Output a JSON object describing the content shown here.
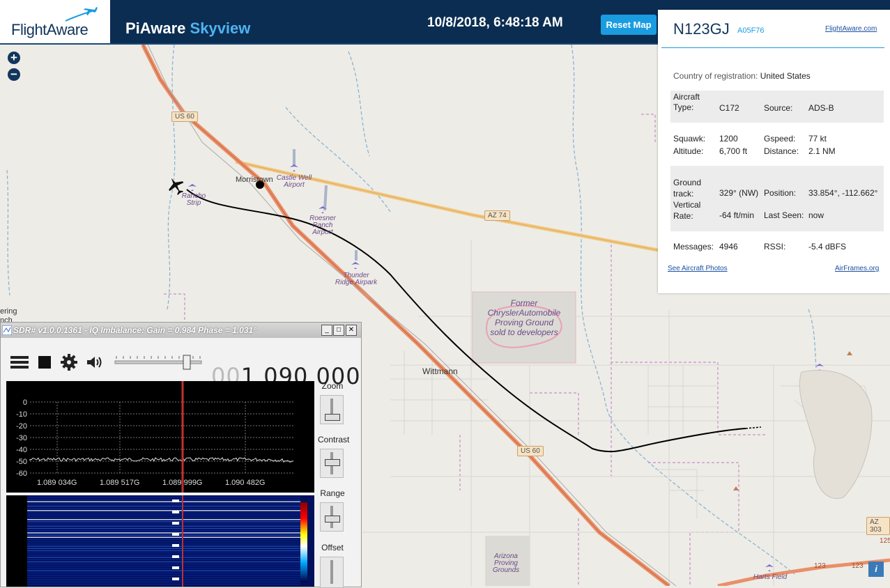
{
  "header": {
    "logo": "FlightAware",
    "title_main": "PiAware ",
    "title_accent": "Skyview",
    "datetime": "10/8/2018, 6:48:18 AM",
    "reset_label": "Reset Map"
  },
  "map": {
    "zoom_in": "+",
    "zoom_out": "−",
    "towns": [
      "Morristown",
      "Wittmann",
      "ering",
      "nch"
    ],
    "roads": [
      "US 60",
      "AZ 74",
      "US 60",
      "AZ 303",
      "125",
      "123",
      "123"
    ],
    "airports": [
      "Castle Well Airport",
      "Rancho Strip",
      "Roesner Ranch Airport",
      "Thunder Ridge Airpark",
      "Harts Field"
    ],
    "areas": [
      "Former ChryslerAutomobile Proving Ground sold to developers",
      "Arizona Proving Grounds"
    ],
    "info_icon": "i"
  },
  "info": {
    "flight": "N123GJ",
    "icao": "A05F76",
    "fa_link": "FlightAware.com",
    "country_label": "Country of registration:",
    "country_value": "United States",
    "aircraft_type_label": "Aircraft Type:",
    "aircraft_type_value": "C172",
    "source_label": "Source:",
    "source_value": "ADS-B",
    "squawk_label": "Squawk:",
    "squawk_value": "1200",
    "gspeed_label": "Gspeed:",
    "gspeed_value": "77 kt",
    "altitude_label": "Altitude:",
    "altitude_value": "6,700 ft",
    "distance_label": "Distance:",
    "distance_value": "2.1 NM",
    "track_label": "Ground track:",
    "track_value": "329° (NW)",
    "position_label": "Position:",
    "position_value": "33.854°, -112.662°",
    "vrate_label": "Vertical Rate:",
    "vrate_value": "-64 ft/min",
    "lastseen_label": "Last Seen:",
    "lastseen_value": "now",
    "messages_label": "Messages:",
    "messages_value": "4946",
    "rssi_label": "RSSI:",
    "rssi_value": "-5.4 dBFS",
    "photos_link": "See Aircraft Photos",
    "airframes_link": "AirFrames.org"
  },
  "sdr": {
    "title": "SDR# v1.0.0.1361 - IQ Imbalance: Gain = 0.984 Phase = 1.031°",
    "freq_dim": "00",
    "freq_main": "1.090.000",
    "db_ticks": [
      "0",
      "-10",
      "-20",
      "-30",
      "-40",
      "-50",
      "-60"
    ],
    "freq_ticks": [
      "1.089 034G",
      "1.089 517G",
      "1.089 999G",
      "1.090 482G"
    ],
    "side_labels": [
      "Zoom",
      "Contrast",
      "Range",
      "Offset"
    ]
  }
}
